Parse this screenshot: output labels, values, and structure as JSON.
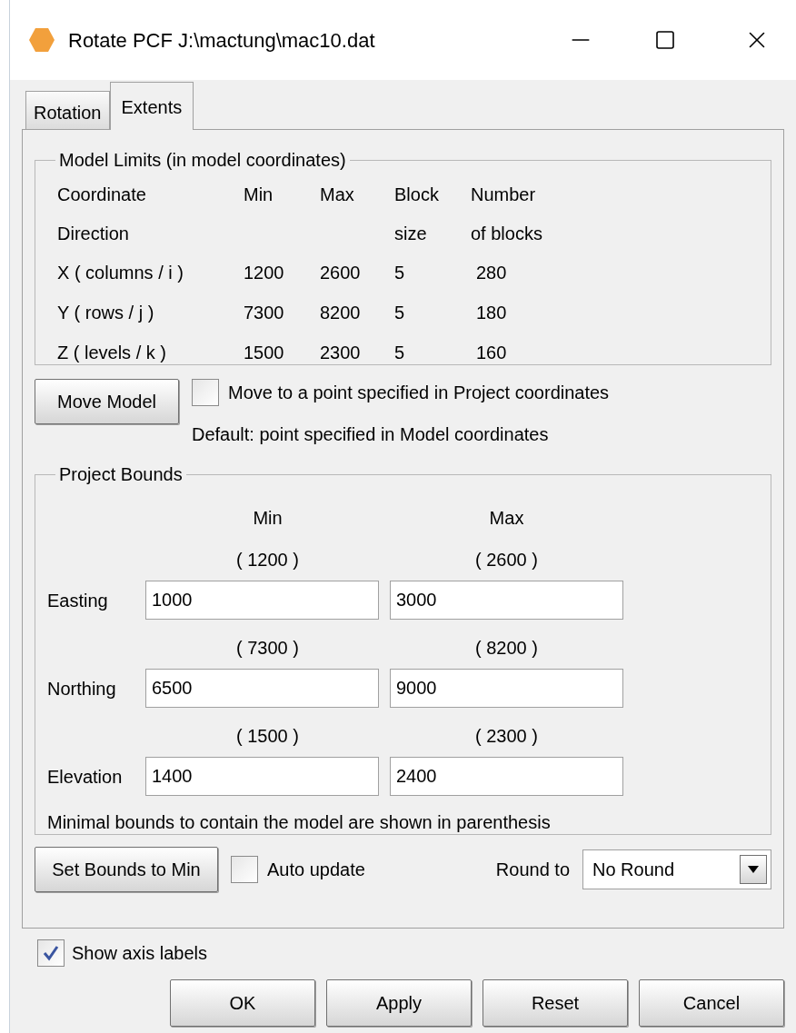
{
  "window": {
    "title": "Rotate PCF J:\\mactung\\mac10.dat"
  },
  "tabs": [
    {
      "label": "Rotation",
      "selected": false
    },
    {
      "label": "Extents",
      "selected": true
    }
  ],
  "model_limits": {
    "title": "Model Limits (in model coordinates)",
    "columns": [
      {
        "line1": "Coordinate",
        "line2": "Direction"
      },
      {
        "line1": "Min"
      },
      {
        "line1": "Max"
      },
      {
        "line1": "Block",
        "line2": "size"
      },
      {
        "line1": "Number",
        "line2": "of blocks"
      }
    ],
    "rows": [
      {
        "axis": "X ( columns / i )",
        "min": "1200",
        "max": "2600",
        "block_size": "5",
        "blocks": "280"
      },
      {
        "axis": "Y ( rows / j )",
        "min": "7300",
        "max": "8200",
        "block_size": "5",
        "blocks": "180"
      },
      {
        "axis": "Z (  levels / k )",
        "min": "1500",
        "max": "2300",
        "block_size": "5",
        "blocks": "160"
      }
    ]
  },
  "move_model": {
    "button": "Move Model",
    "checkbox": {
      "label": "Move to a point specified in Project coordinates",
      "checked": false
    },
    "note": "Default: point specified in Model coordinates"
  },
  "project_bounds": {
    "title": "Project Bounds",
    "min_header": "Min",
    "max_header": "Max",
    "rows": [
      {
        "label": "Easting",
        "min_hint": "( 1200 )",
        "max_hint": "( 2600 )",
        "min_value": "1000",
        "max_value": "3000"
      },
      {
        "label": "Northing",
        "min_hint": "( 7300 )",
        "max_hint": "( 8200 )",
        "min_value": "6500",
        "max_value": "9000"
      },
      {
        "label": "Elevation",
        "min_hint": "( 1500 )",
        "max_hint": "( 2300 )",
        "min_value": "1400",
        "max_value": "2400"
      }
    ],
    "note": "Minimal bounds to contain the model are shown in parenthesis"
  },
  "bottom": {
    "set_bounds_button": "Set Bounds to Min",
    "auto_update": {
      "label": "Auto update",
      "checked": false
    },
    "round_label": "Round to",
    "round_value": "No Round"
  },
  "show_axis_labels": {
    "label": "Show axis labels",
    "checked": true
  },
  "buttons": [
    "OK",
    "Apply",
    "Reset",
    "Cancel"
  ]
}
